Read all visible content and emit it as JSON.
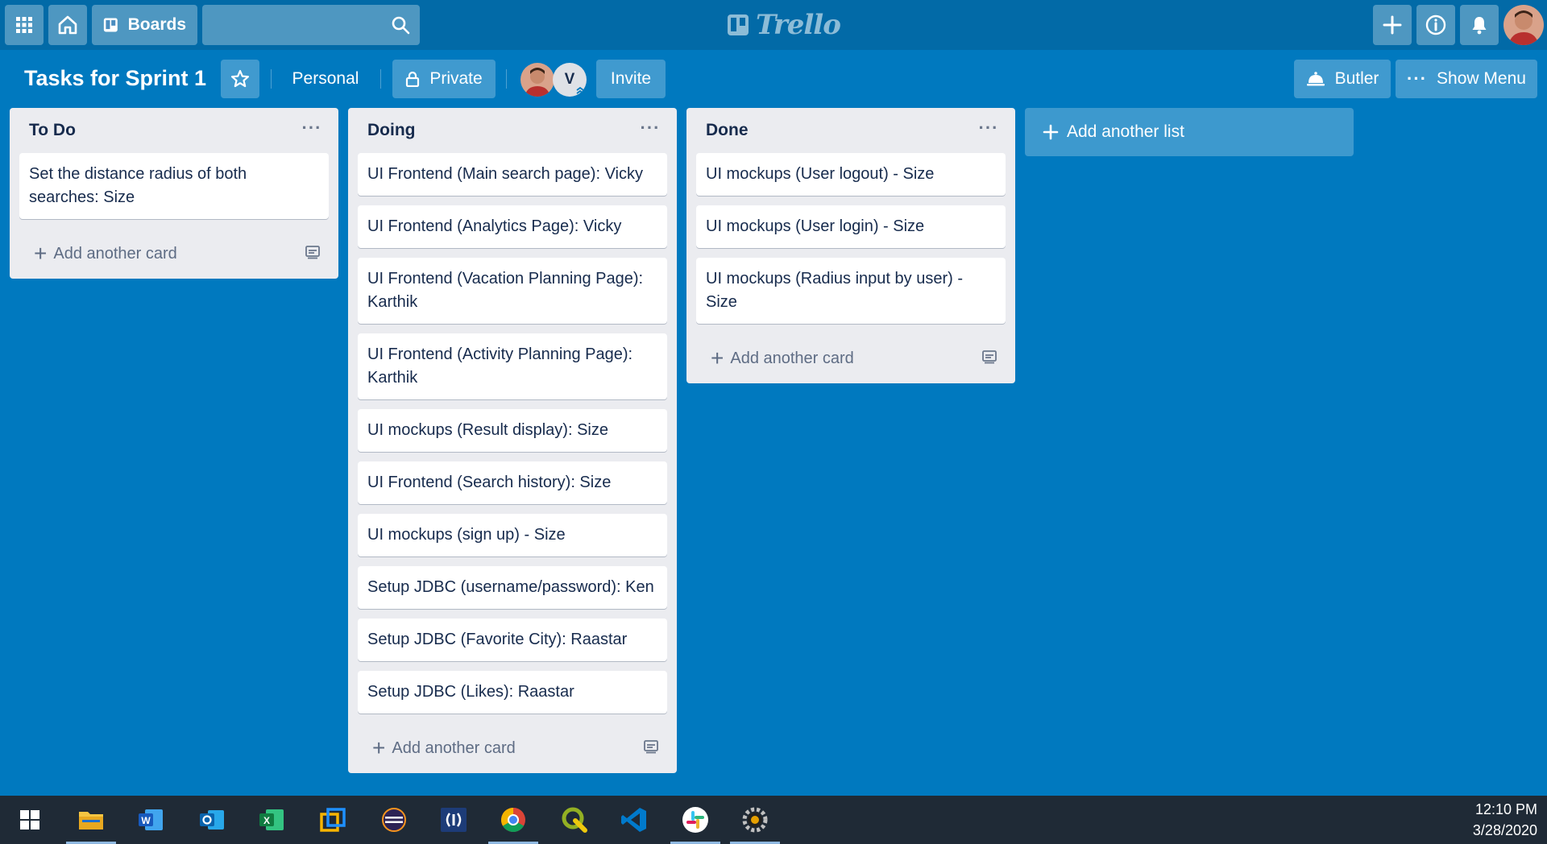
{
  "header": {
    "boards_label": "Boards",
    "search_placeholder": "",
    "logo_text": "Trello"
  },
  "board": {
    "title": "Tasks for Sprint 1",
    "team_label": "Personal",
    "visibility_label": "Private",
    "member_initial": "V",
    "invite_label": "Invite",
    "butler_label": "Butler",
    "show_menu_label": "Show Menu"
  },
  "lists": [
    {
      "title": "To Do",
      "cards": [
        "Set the distance radius of both searches: Size"
      ],
      "add_card_label": "Add another card"
    },
    {
      "title": "Doing",
      "cards": [
        "UI Frontend (Main search page): Vicky",
        "UI Frontend (Analytics Page): Vicky",
        "UI Frontend (Vacation Planning Page): Karthik",
        "UI Frontend (Activity Planning Page): Karthik",
        "UI mockups (Result display): Size",
        "UI Frontend (Search history): Size",
        "UI mockups (sign up) - Size",
        "Setup JDBC (username/password): Ken",
        "Setup JDBC (Favorite City): Raastar",
        "Setup JDBC (Likes): Raastar"
      ],
      "add_card_label": "Add another card"
    },
    {
      "title": "Done",
      "cards": [
        "UI mockups (User logout) - Size",
        "UI mockups (User login) - Size",
        "UI mockups (Radius input by user) - Size"
      ],
      "add_card_label": "Add another card"
    }
  ],
  "add_list_label": "Add another list",
  "taskbar": {
    "time": "12:10 PM",
    "date": "3/28/2020",
    "apps": [
      "start-icon",
      "file-explorer-icon",
      "word-icon",
      "outlook-icon",
      "excel-icon",
      "virtualbox-icon",
      "eclipse-icon",
      "remote-desktop-icon",
      "chrome-icon",
      "qgis-icon",
      "vscode-icon",
      "slack-icon",
      "settings-gear-icon"
    ]
  },
  "colors": {
    "board_bg": "#0079bf",
    "header_bg": "#026aa7",
    "list_bg": "#ebecf0",
    "taskbar_bg": "#1f2a36"
  }
}
